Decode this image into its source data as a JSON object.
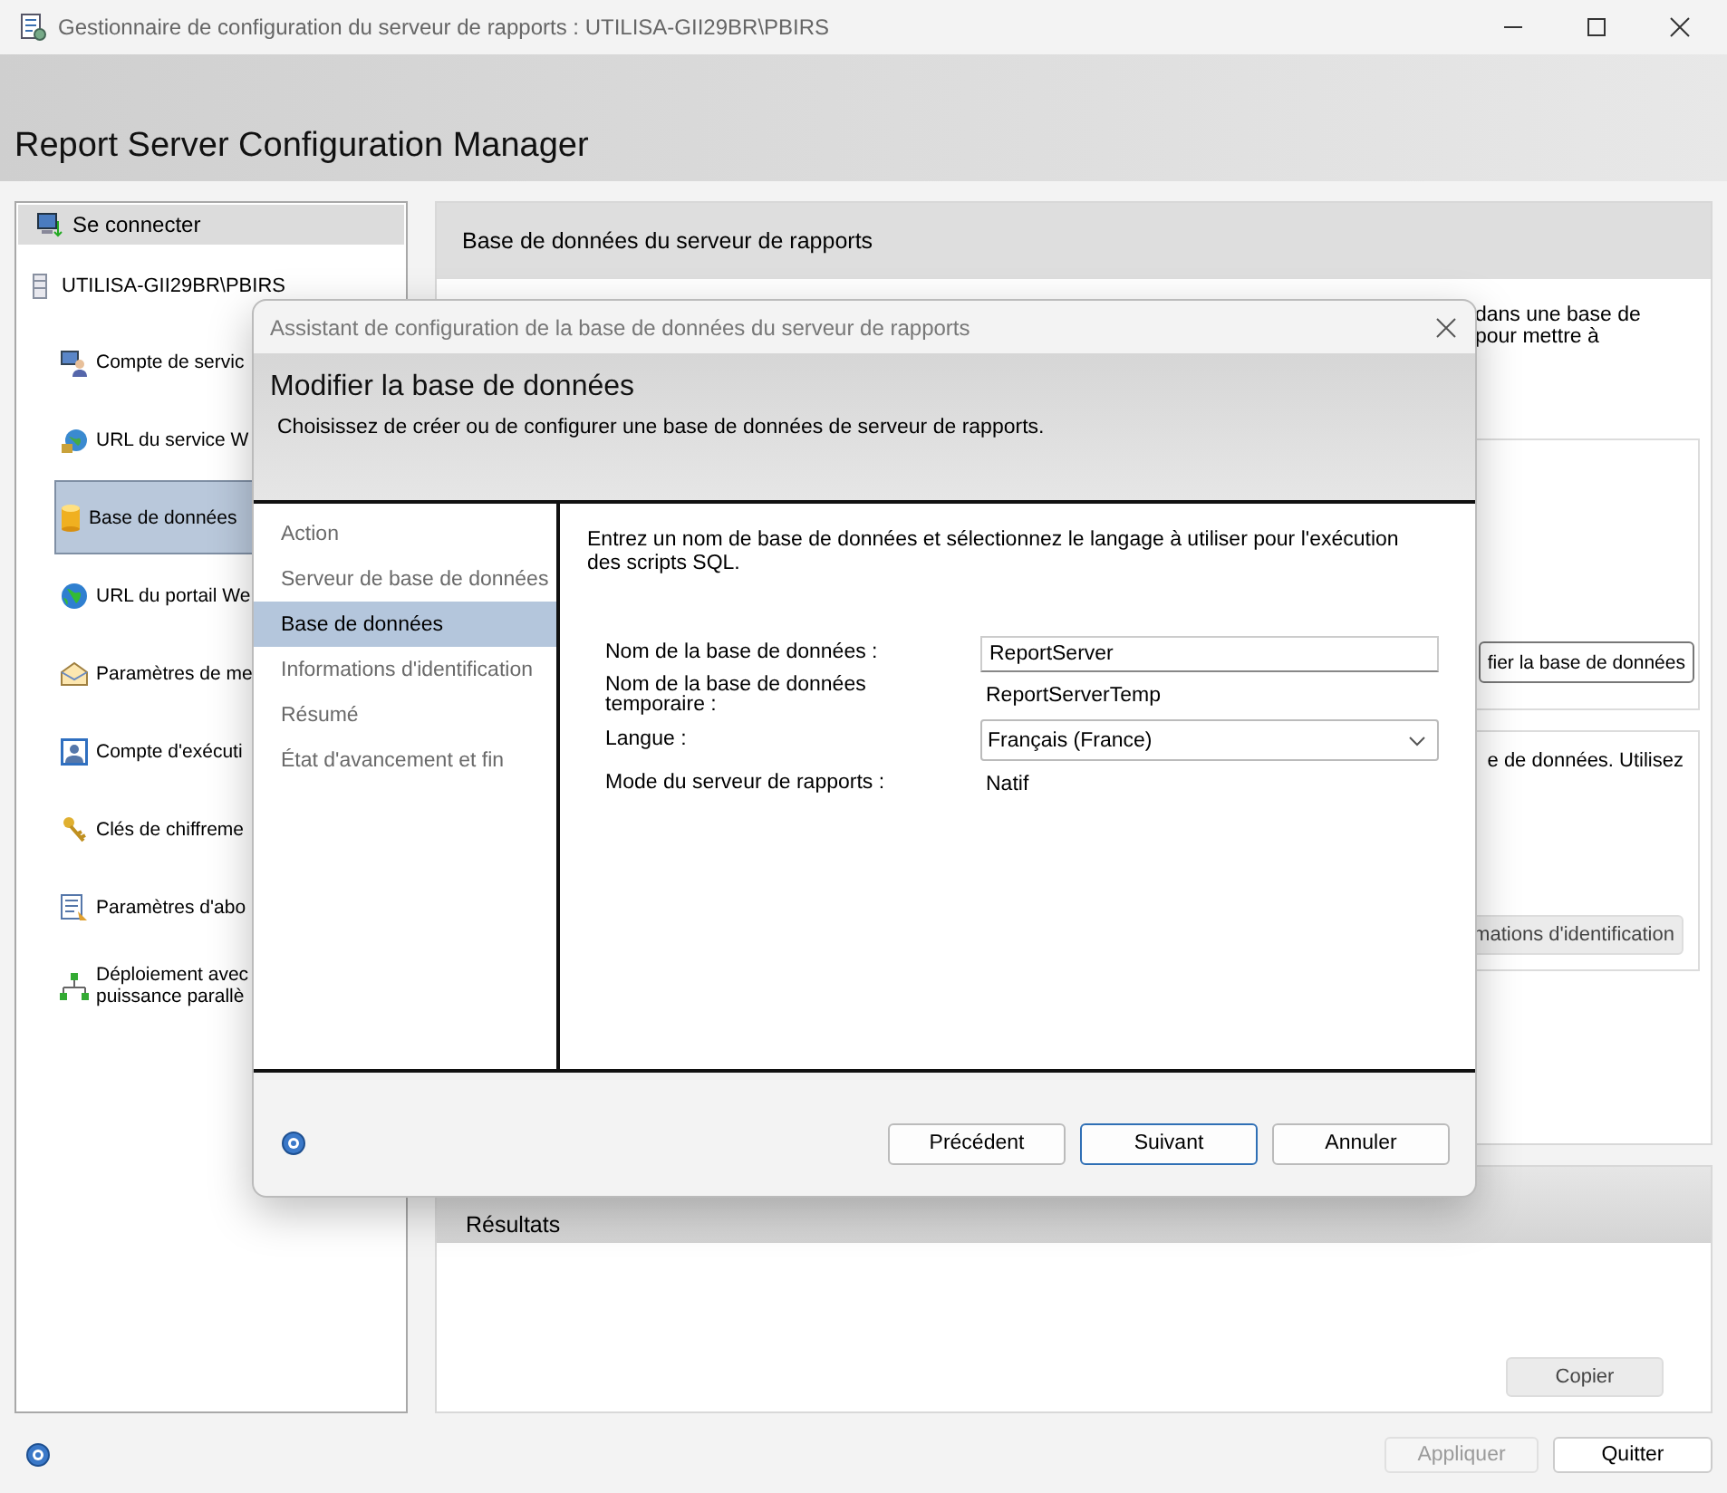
{
  "window": {
    "title": "Gestionnaire de configuration du serveur de rapports : UTILISA-GII29BR\\PBIRS"
  },
  "app_title": "Report Server Configuration Manager",
  "sidebar": {
    "connect": "Se connecter",
    "server": "UTILISA-GII29BR\\PBIRS",
    "items": [
      {
        "lines": [
          "Compte de servic"
        ],
        "selected": false
      },
      {
        "lines": [
          "URL du service W"
        ],
        "selected": false
      },
      {
        "lines": [
          "Base de données"
        ],
        "selected": true
      },
      {
        "lines": [
          "URL du portail We"
        ],
        "selected": false
      },
      {
        "lines": [
          "Paramètres de me"
        ],
        "selected": false
      },
      {
        "lines": [
          "Compte d'exécuti"
        ],
        "selected": false
      },
      {
        "lines": [
          "Clés de chiffreme"
        ],
        "selected": false
      },
      {
        "lines": [
          "Paramètres d'abo"
        ],
        "selected": false
      },
      {
        "lines": [
          "Déploiement avec",
          "puissance parallè"
        ],
        "selected": false
      }
    ]
  },
  "main_panel": {
    "title": "Base de données du serveur de rapports",
    "intro_lines": [
      "dans une base de",
      "pour mettre à"
    ],
    "modify_button": "fier la base de données",
    "credentials_text": "e de données. Utilisez",
    "credentials_button": "mations d'identification"
  },
  "results": {
    "title": "Résultats",
    "copy_button": "Copier"
  },
  "footer": {
    "buttons": [
      {
        "label": "Appliquer",
        "disabled": true
      },
      {
        "label": "Quitter",
        "disabled": false
      }
    ]
  },
  "dialog": {
    "title": "Assistant de configuration de la base de données du serveur de rapports",
    "heading": "Modifier la base de données",
    "subheading": "Choisissez de créer ou de configurer une base de données de serveur de rapports.",
    "steps": [
      {
        "label": "Action",
        "selected": false
      },
      {
        "label": "Serveur de base de données",
        "selected": false
      },
      {
        "label": "Base de données",
        "selected": true
      },
      {
        "label": "Informations d'identification",
        "selected": false
      },
      {
        "label": "Résumé",
        "selected": false
      },
      {
        "label": "État d'avancement et fin",
        "selected": false
      }
    ],
    "instructions": "Entrez un nom de base de données et sélectionnez le langage à utiliser pour l'exécution des scripts SQL.",
    "fields": [
      {
        "kind": "input",
        "label": "Nom de la base de données :",
        "value": "ReportServer"
      },
      {
        "kind": "text",
        "label": "Nom de la base de données temporaire :",
        "value": "ReportServerTemp"
      },
      {
        "kind": "select",
        "label": "Langue :",
        "value": "Français (France)"
      },
      {
        "kind": "text",
        "label": "Mode du serveur de rapports :",
        "value": "Natif"
      }
    ],
    "buttons": [
      {
        "label": "Précédent",
        "default": false
      },
      {
        "label": "Suivant",
        "default": true
      },
      {
        "label": "Annuler",
        "default": false
      }
    ]
  }
}
